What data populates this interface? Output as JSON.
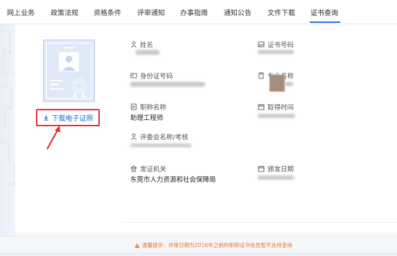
{
  "nav": {
    "items": [
      {
        "label": "网上业务"
      },
      {
        "label": "政策法规"
      },
      {
        "label": "资格条件"
      },
      {
        "label": "评审通知"
      },
      {
        "label": "办事指南"
      },
      {
        "label": "通知公告"
      },
      {
        "label": "文件下载"
      },
      {
        "label": "证书查询"
      }
    ],
    "active": "证书查询"
  },
  "certificate": {
    "download_label": "下载电子证照",
    "fields": {
      "name_label": "姓名",
      "cert_no_label": "证书号码",
      "id_no_label": "身份证号码",
      "major_label": "专业名称",
      "title_label": "职称名称",
      "title_value": "助理工程师",
      "obtain_time_label": "取得时间",
      "committee_label": "评委会名称/考核",
      "issuer_label": "发证机关",
      "issuer_value": "东莞市人力资源和社会保障局",
      "issue_date_label": "颁发日期"
    }
  },
  "footer": {
    "warning_text": "温馨提示：评审日期为2016年之前的职称证书信息暂不支持查询"
  },
  "colors": {
    "accent": "#1e6fd9",
    "highlight_red": "#e03030",
    "warning_orange": "#e6782b"
  }
}
